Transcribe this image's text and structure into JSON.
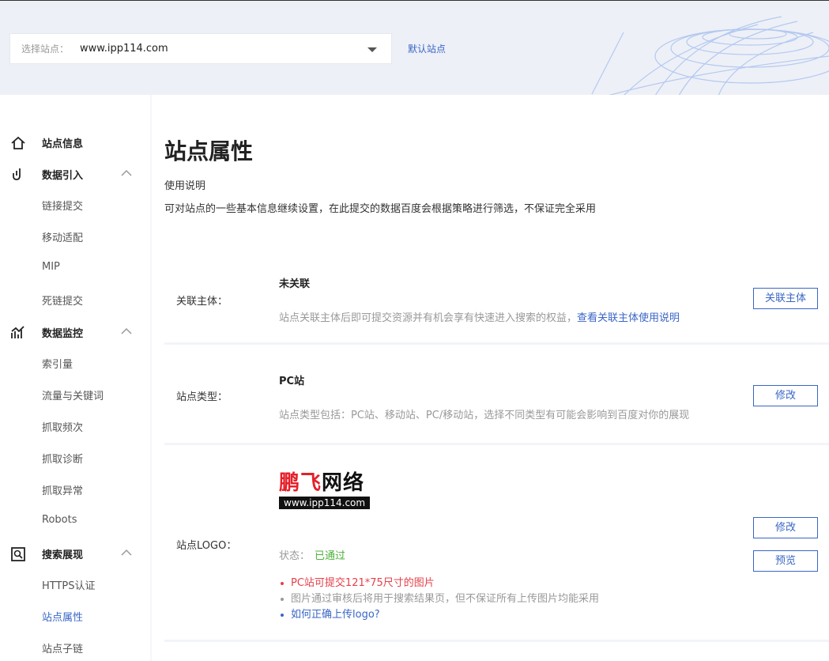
{
  "header": {
    "site_select_label": "选择站点：",
    "site_select_value": "www.ipp114.com",
    "default_site_link": "默认站点"
  },
  "sidebar": {
    "site_info": "站点信息",
    "data_import": {
      "label": "数据引入",
      "items": [
        "链接提交",
        "移动适配",
        "MIP",
        "死链提交"
      ]
    },
    "data_monitor": {
      "label": "数据监控",
      "items": [
        "索引量",
        "流量与关键词",
        "抓取频次",
        "抓取诊断",
        "抓取异常",
        "Robots"
      ]
    },
    "search_display": {
      "label": "搜索展现",
      "items": [
        "HTTPS认证",
        "站点属性",
        "站点子链"
      ],
      "active_item": "站点属性"
    }
  },
  "main": {
    "title": "站点属性",
    "usage_title": "使用说明",
    "usage_desc": "可对站点的一些基本信息继续设置，在此提交的数据百度会根据策略进行筛选，不保证完全采用",
    "subject": {
      "label": "关联主体：",
      "value": "未关联",
      "desc": "站点关联主体后即可提交资源并有机会享有快速进入搜索的权益，",
      "desc_link": "查看关联主体使用说明",
      "button": "关联主体"
    },
    "site_type": {
      "label": "站点类型：",
      "value": "PC站",
      "desc": "站点类型包括：PC站、移动站、PC/移动站，选择不同类型有可能会影响到百度对你的展现",
      "button": "修改"
    },
    "site_logo": {
      "label": "站点LOGO：",
      "logo_text_red": "鹏飞",
      "logo_text_black": "网络",
      "logo_url": "www.ipp114.com",
      "status_label": "状态：",
      "status_value": "已通过",
      "notes": [
        "PC站可提交121*75尺寸的图片",
        "图片通过审核后将用于搜索结果页，但不保证所有上传图片均能采用",
        "如何正确上传logo?"
      ],
      "edit_button": "修改",
      "preview_button": "预览"
    }
  },
  "colors": {
    "accent": "#3a66c6",
    "warning": "#e5404a",
    "success": "#4caf3a",
    "logo_red": "#e5202a"
  }
}
